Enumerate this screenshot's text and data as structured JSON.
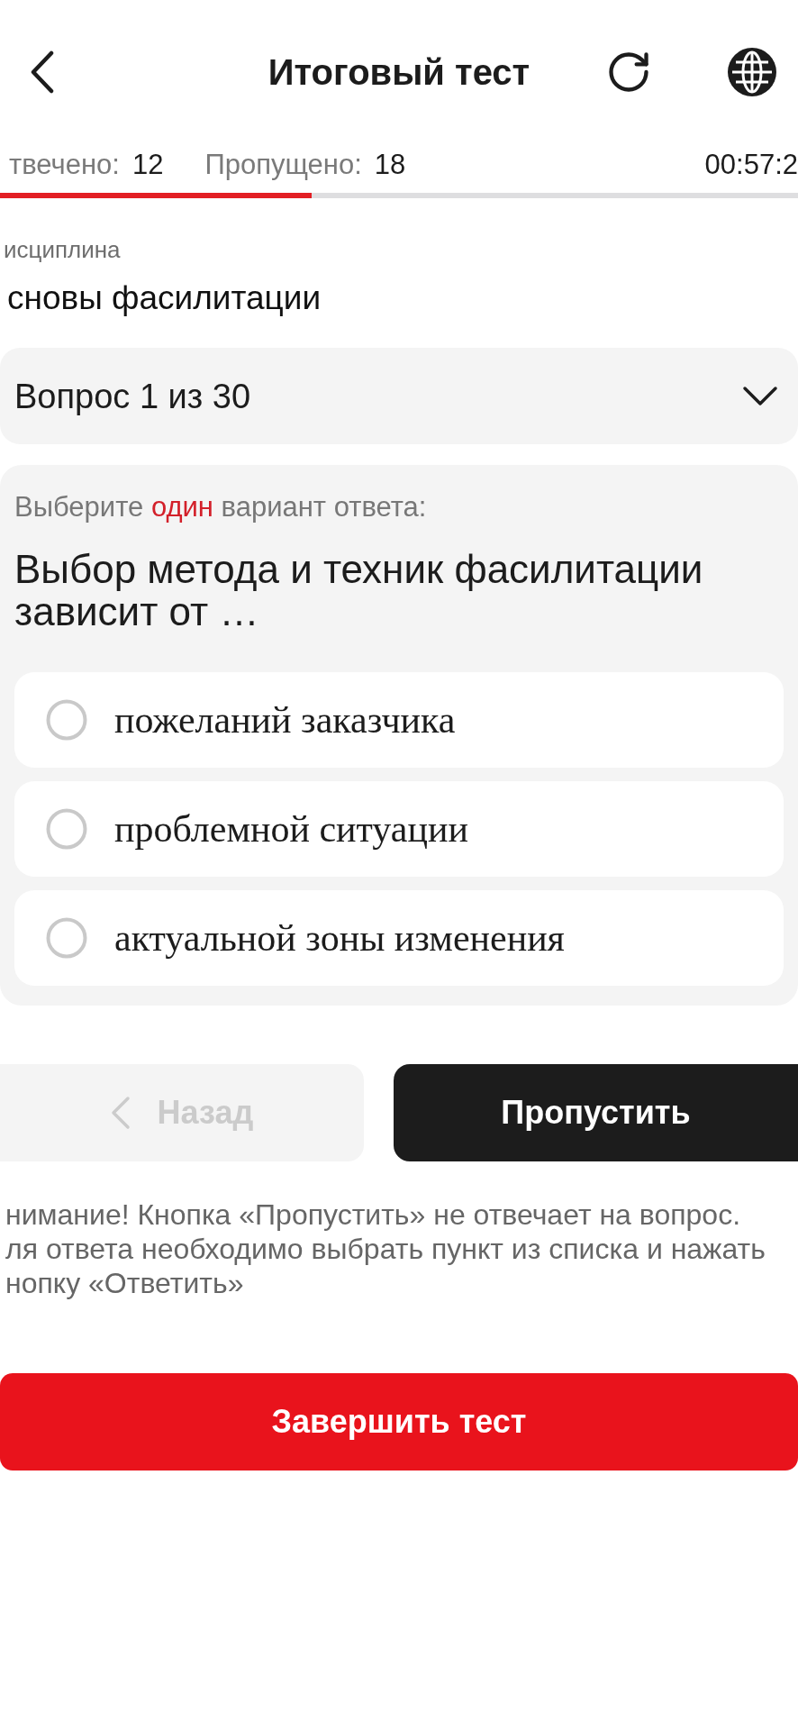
{
  "header": {
    "title": "Итоговый тест"
  },
  "stats": {
    "answered_label": "твечено:",
    "answered_value": "12",
    "skipped_label": "Пропущено:",
    "skipped_value": "18",
    "timer": "00:57:2"
  },
  "progress": {
    "level": 0.39
  },
  "discipline": {
    "label": "исциплина",
    "value": "сновы фасилитации"
  },
  "question_selector": {
    "value": "Вопрос 1 из 30",
    "expanded": false
  },
  "question": {
    "instruction": [
      {
        "text": "Выберите ",
        "highlight": false
      },
      {
        "text": "один",
        "highlight": true
      },
      {
        "text": " вариант ответа:",
        "highlight": false
      }
    ],
    "text": "Выбор метода и техник фасилитации зависит от …",
    "options": [
      {
        "text": "пожеланий заказчика",
        "selected": false
      },
      {
        "text": "проблемной ситуации",
        "selected": false
      },
      {
        "text": "актуальной зоны изменения",
        "selected": false
      }
    ]
  },
  "navigation": {
    "back": {
      "label": "Назад",
      "disabled": true
    },
    "skip": {
      "label": "Пропустить"
    }
  },
  "notice": "нимание! Кнопка «Пропустить» не отвечает на вопрос.\nля ответа необходимо выбрать пункт из списка и нажать\nнопку «Ответить»",
  "finish_button": {
    "label": "Завершить тест"
  }
}
